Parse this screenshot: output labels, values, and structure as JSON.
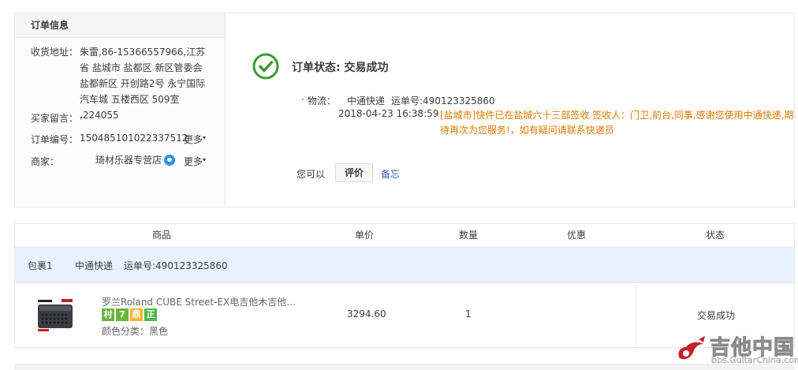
{
  "order_info": {
    "title": "订单信息",
    "address_label": "收货地址：",
    "address_value": "朱雷,86-15366557966,江苏省 盐城市 盐都区 新区管委会 盐都新区 开创路2号 永宁国际汽车城 五楼西区 509室 ,224055",
    "buyer_note_label": "买家留言：",
    "buyer_note_value": "-",
    "order_no_label": "订单编号：",
    "order_no_value": "150485101022337512",
    "more_label": "更多",
    "seller_label": "商家：",
    "seller_value": "琦材乐器专营店",
    "seller_more_label": "更多"
  },
  "status": {
    "title": "订单状态: 交易成功",
    "logistics_label": "物流：",
    "company": "中通快递",
    "waybill": "运单号:490123325860",
    "time": "2018-04-23 16:38:59",
    "detail": "[盐城市]快件已在盐城六十三部签收 签收人：门卫,前台,同事,感谢您使用中通快递,期待再次为您服务!，如有疑问请联系快递员",
    "you_can": "您可以",
    "rate_button": "评价",
    "memo_link": "备忘"
  },
  "table": {
    "headers": [
      "商品",
      "单价",
      "数量",
      "优惠",
      "状态"
    ],
    "package": {
      "label": "包裹1",
      "company": "中通快递",
      "waybill": "运单号:490123325860"
    },
    "item": {
      "name": "罗兰Roland CUBE Street-EX电吉他木吉他…",
      "badges": [
        "村",
        "7",
        "鼎",
        "正"
      ],
      "sku": "颜色分类：黑色",
      "price": "3294.60",
      "qty": "1",
      "status": "交易成功"
    }
  },
  "watermark": {
    "text": "吉他中国",
    "url": "bbs.GuitarChina.com"
  },
  "colors": {
    "success_green": "#3a9a2f",
    "logistics_orange": "#e07700",
    "link_blue": "#3366cc",
    "package_bg": "#e8f2fe"
  }
}
